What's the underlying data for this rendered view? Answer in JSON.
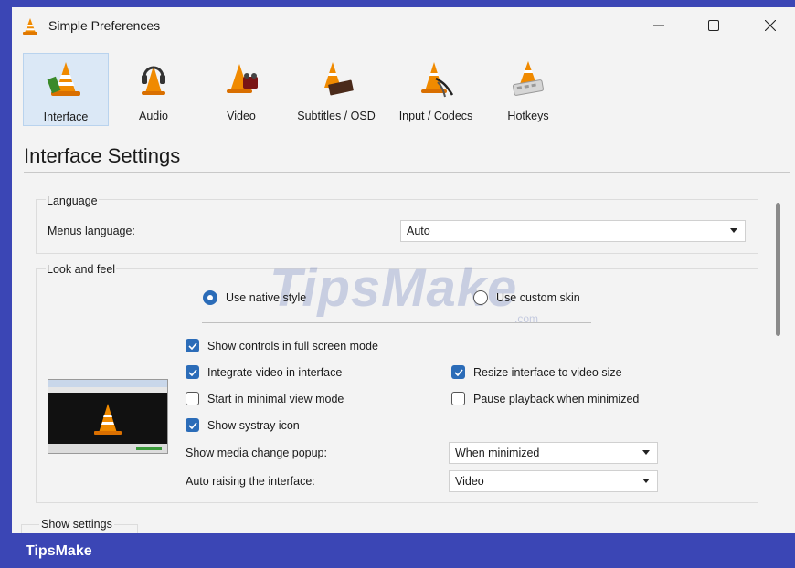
{
  "window": {
    "title": "Simple Preferences"
  },
  "toolbar": {
    "items": [
      {
        "label": "Interface",
        "icon": "interface-cone-icon",
        "active": true
      },
      {
        "label": "Audio",
        "icon": "audio-headphones-icon",
        "active": false
      },
      {
        "label": "Video",
        "icon": "video-cone-icon",
        "active": false
      },
      {
        "label": "Subtitles / OSD",
        "icon": "subtitles-cone-icon",
        "active": false
      },
      {
        "label": "Input / Codecs",
        "icon": "input-codecs-icon",
        "active": false
      },
      {
        "label": "Hotkeys",
        "icon": "hotkeys-cone-icon",
        "active": false
      }
    ]
  },
  "section": {
    "title": "Interface Settings"
  },
  "language": {
    "group_label": "Language",
    "menus_language_label": "Menus language:",
    "menus_language_value": "Auto"
  },
  "look_and_feel": {
    "group_label": "Look and feel",
    "radio_native": "Use native style",
    "radio_native_checked": true,
    "radio_custom": "Use custom skin",
    "radio_custom_checked": false,
    "checkboxes": {
      "fullscreen_controls": {
        "label": "Show controls in full screen mode",
        "checked": true
      },
      "integrate_video": {
        "label": "Integrate video in interface",
        "checked": true
      },
      "resize_interface": {
        "label": "Resize interface to video size",
        "checked": true
      },
      "minimal_view": {
        "label": "Start in minimal view mode",
        "checked": false
      },
      "pause_minimized": {
        "label": "Pause playback when minimized",
        "checked": false
      },
      "systray_icon": {
        "label": "Show systray icon",
        "checked": true
      }
    },
    "media_popup_label": "Show media change popup:",
    "media_popup_value": "When minimized",
    "auto_raise_label": "Auto raising the interface:",
    "auto_raise_value": "Video"
  },
  "show_settings": {
    "label": "Show settings"
  },
  "watermark": {
    "text": "TipsMake",
    "suffix": ".com"
  },
  "footer": {
    "brand": "TipsMake"
  },
  "colors": {
    "accent": "#2b6cb8",
    "band": "#3b46b5",
    "window_bg": "#f3f3f3"
  }
}
